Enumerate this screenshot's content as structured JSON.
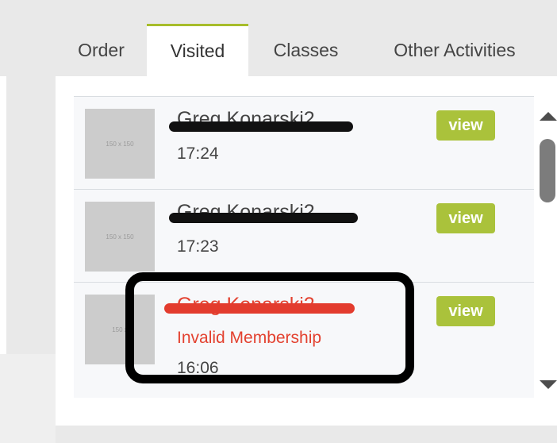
{
  "tabs": [
    {
      "label": "Order"
    },
    {
      "label": "Visited"
    },
    {
      "label": "Classes"
    },
    {
      "label": "Other Activities"
    }
  ],
  "active_tab": "Visited",
  "visits": [
    {
      "thumb": "150 x 150",
      "name": "Greg Konarski2",
      "status": "",
      "time": "17:24",
      "action": "view"
    },
    {
      "thumb": "150 x 150",
      "name": "Greg Konarski2",
      "status": "",
      "time": "17:23",
      "action": "view"
    },
    {
      "thumb": "150 x",
      "name": "Greg Konarski2",
      "status": "Invalid Membership",
      "time": "16:06",
      "action": "view"
    }
  ],
  "colors": {
    "accent": "#aac23b",
    "error": "#e3412f",
    "tab_border": "#a7bd2b"
  }
}
